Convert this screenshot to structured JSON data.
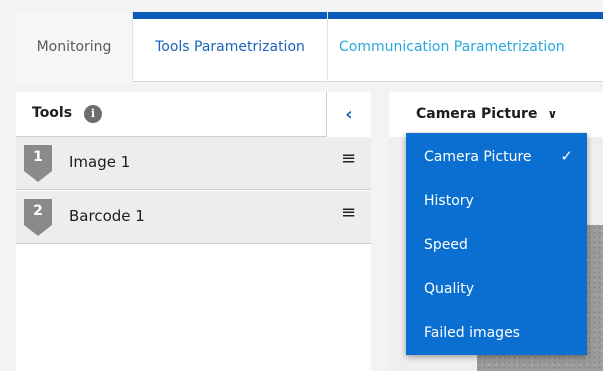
{
  "tabs": [
    {
      "label": "Monitoring"
    },
    {
      "label": "Tools Parametrization"
    },
    {
      "label": "Communication Parametrization"
    }
  ],
  "tools_panel": {
    "title": "Tools",
    "info_icon": "info-icon",
    "collapse_glyph": "‹",
    "items": [
      {
        "number": "1",
        "label": "Image 1",
        "menu_glyph": "≡"
      },
      {
        "number": "2",
        "label": "Barcode 1",
        "menu_glyph": "≡"
      }
    ]
  },
  "view": {
    "selected": "Camera Picture",
    "chevron": "⌄",
    "options": [
      "Camera Picture",
      "History",
      "Speed",
      "Quality",
      "Failed images"
    ],
    "check_glyph": "✓"
  },
  "colors": {
    "accent": "#0b5bb8",
    "dropdown_bg": "#0a6fd0",
    "link_blue": "#1a63b8",
    "comm_tab": "#27a8df",
    "badge": "#8a8a8a"
  }
}
